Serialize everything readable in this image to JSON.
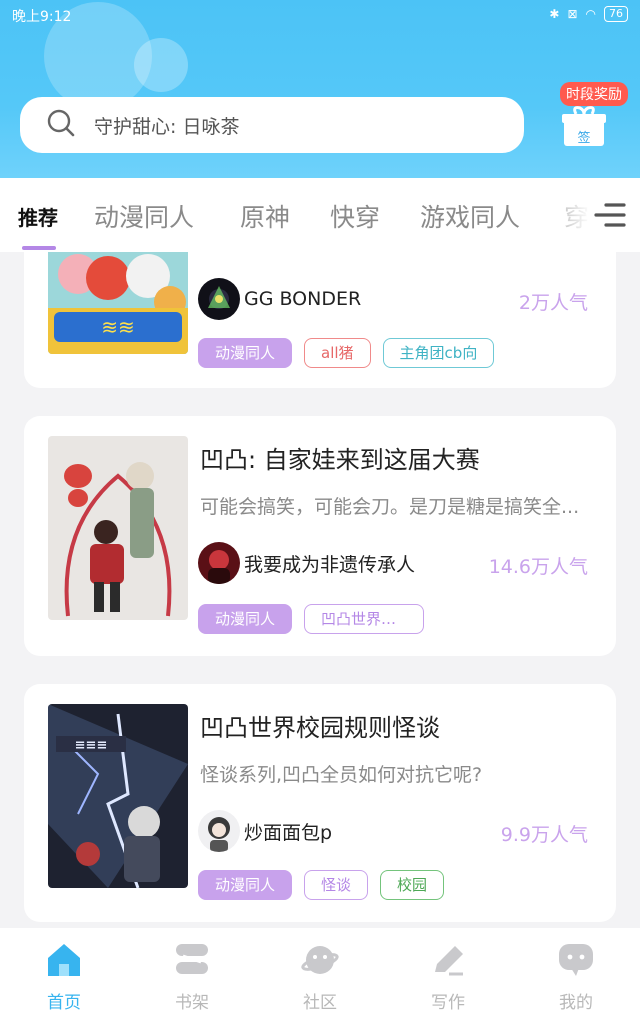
{
  "status": {
    "time": "晚上9:12",
    "battery": "76"
  },
  "search": {
    "placeholder": "守护甜心: 日咏茶"
  },
  "reward": {
    "label": "时段奖励",
    "sign": "签"
  },
  "tabs": [
    {
      "label": "推荐",
      "active": true
    },
    {
      "label": "动漫同人"
    },
    {
      "label": "原神"
    },
    {
      "label": "快穿"
    },
    {
      "label": "游戏同人"
    },
    {
      "label": "穿"
    }
  ],
  "books": [
    {
      "title": "",
      "description": "",
      "author": "GG BONDER",
      "popularity": "2万人气",
      "tags": [
        {
          "label": "动漫同人",
          "style": "filled"
        },
        {
          "label": "all猪",
          "style": "red"
        },
        {
          "label": "主角团cb向",
          "style": "teal"
        }
      ]
    },
    {
      "title": "凹凸: 自家娃来到这届大赛",
      "description": "可能会搞笑，可能会刀。是刀是糖是搞笑全...",
      "author": "我要成为非遗传承人",
      "popularity": "14.6万人气",
      "tags": [
        {
          "label": "动漫同人",
          "style": "filled"
        },
        {
          "label": "凹凸世界同...",
          "style": "purple"
        }
      ]
    },
    {
      "title": "凹凸世界校园规则怪谈",
      "description": "怪谈系列,凹凸全员如何对抗它呢?",
      "author": "炒面面包p",
      "popularity": "9.9万人气",
      "tags": [
        {
          "label": "动漫同人",
          "style": "filled"
        },
        {
          "label": "怪谈",
          "style": "purple"
        },
        {
          "label": "校园",
          "style": "green"
        }
      ]
    }
  ],
  "nav": [
    {
      "label": "首页",
      "icon": "home-icon",
      "active": true
    },
    {
      "label": "书架",
      "icon": "bookshelf-icon"
    },
    {
      "label": "社区",
      "icon": "community-icon"
    },
    {
      "label": "写作",
      "icon": "write-icon"
    },
    {
      "label": "我的",
      "icon": "profile-icon"
    }
  ],
  "colors": {
    "accent": "#37b4ef",
    "tag_purple": "#c8a2ec",
    "header": "#4cc3f6"
  }
}
